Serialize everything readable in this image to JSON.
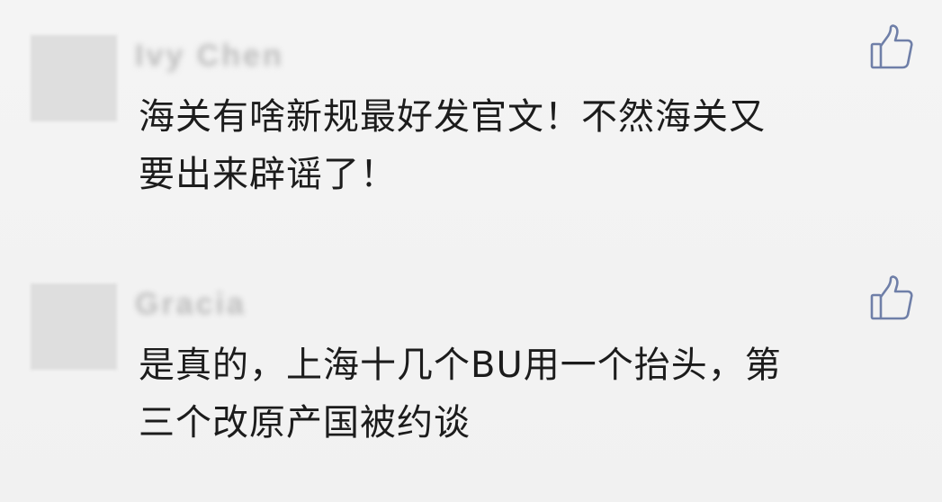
{
  "comments": [
    {
      "username": "Ivy Chen",
      "text": "海关有啥新规最好发官文！不然海关又\n要出来辟谣了！",
      "like_icon": "thumbs-up-icon"
    },
    {
      "username": "Gracia",
      "text": "是真的，上海十几个BU用一个抬头，第\n三个改原产国被约谈",
      "like_icon": "thumbs-up-icon"
    }
  ],
  "colors": {
    "background": "#f2f2f2",
    "text": "#1c1c1c",
    "icon": "#6f7fa8",
    "avatar": "#dedede",
    "username": "#bdbdbd"
  }
}
